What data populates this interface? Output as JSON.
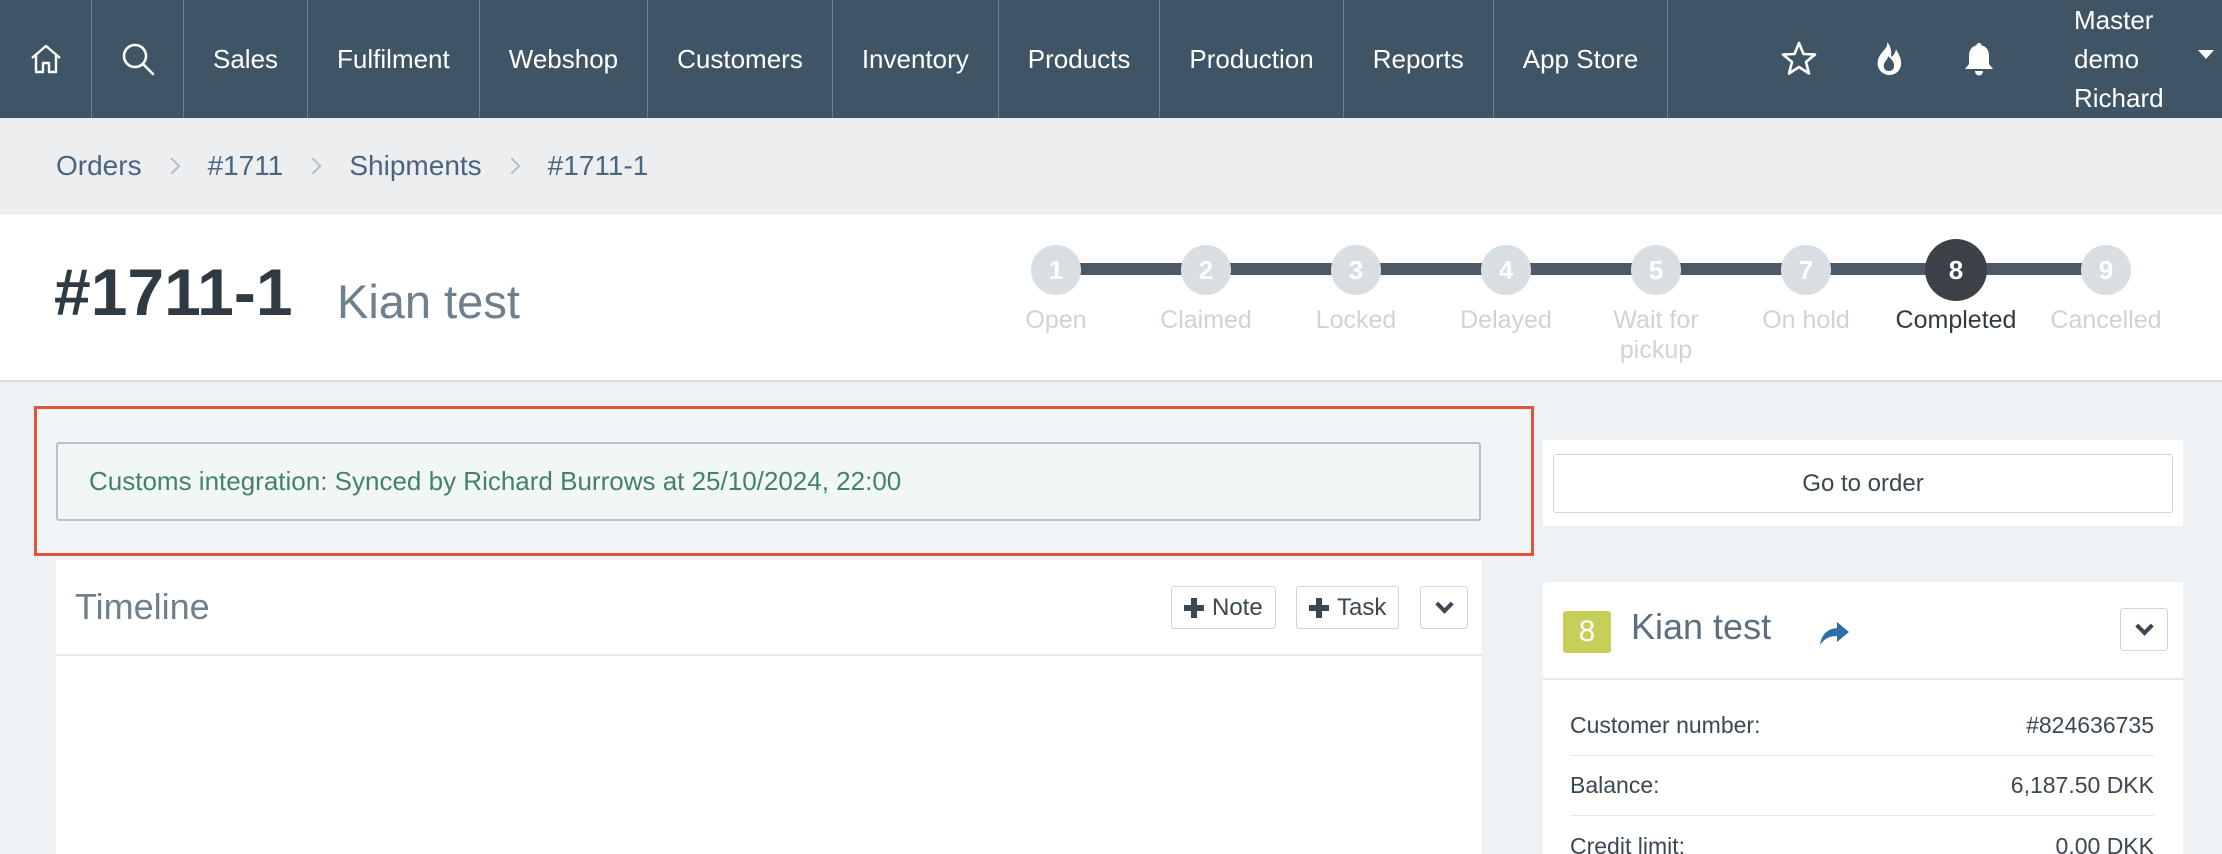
{
  "nav": {
    "items": [
      {
        "label": "Sales",
        "name": "nav-sales"
      },
      {
        "label": "Fulfilment",
        "name": "nav-fulfilment"
      },
      {
        "label": "Webshop",
        "name": "nav-webshop"
      },
      {
        "label": "Customers",
        "name": "nav-customers"
      },
      {
        "label": "Inventory",
        "name": "nav-inventory"
      },
      {
        "label": "Products",
        "name": "nav-products"
      },
      {
        "label": "Production",
        "name": "nav-production"
      },
      {
        "label": "Reports",
        "name": "nav-reports"
      },
      {
        "label": "App Store",
        "name": "nav-app-store"
      }
    ],
    "icons": [
      "home-icon",
      "search-icon",
      "star-icon",
      "flame-icon",
      "bell-icon"
    ],
    "user": {
      "line1": "Master demo",
      "line2": "Richard"
    }
  },
  "breadcrumb": [
    "Orders",
    "#1711",
    "Shipments",
    "#1711-1"
  ],
  "header": {
    "order_id": "#1711-1",
    "customer_name": "Kian test"
  },
  "stepper": {
    "steps": [
      {
        "number": "1",
        "label": "Open"
      },
      {
        "number": "2",
        "label": "Claimed"
      },
      {
        "number": "3",
        "label": "Locked"
      },
      {
        "number": "4",
        "label": "Delayed"
      },
      {
        "number": "5",
        "label": "Wait for pickup"
      },
      {
        "number": "7",
        "label": "On hold"
      },
      {
        "number": "8",
        "label": "Completed"
      },
      {
        "number": "9",
        "label": "Cancelled"
      }
    ],
    "active_step": "8"
  },
  "sync_alert": "Customs integration: Synced by Richard Burrows at 25/10/2024, 22:00",
  "timeline": {
    "title": "Timeline",
    "note_label": "Note",
    "task_label": "Task"
  },
  "goto_order_label": "Go to order",
  "customer": {
    "badge": "8",
    "name": "Kian test",
    "rows": [
      {
        "label": "Customer number:",
        "value": "#824636735"
      },
      {
        "label": "Balance:",
        "value": "6,187.50 DKK"
      },
      {
        "label": "Credit limit:",
        "value": "0.00 DKK"
      }
    ]
  },
  "colors": {
    "nav_bg": "#3f5465",
    "highlight_border": "#e0533d",
    "alert_text": "#44806e",
    "badge_bg": "#c6cf5a",
    "active_step": "#3d4248"
  }
}
